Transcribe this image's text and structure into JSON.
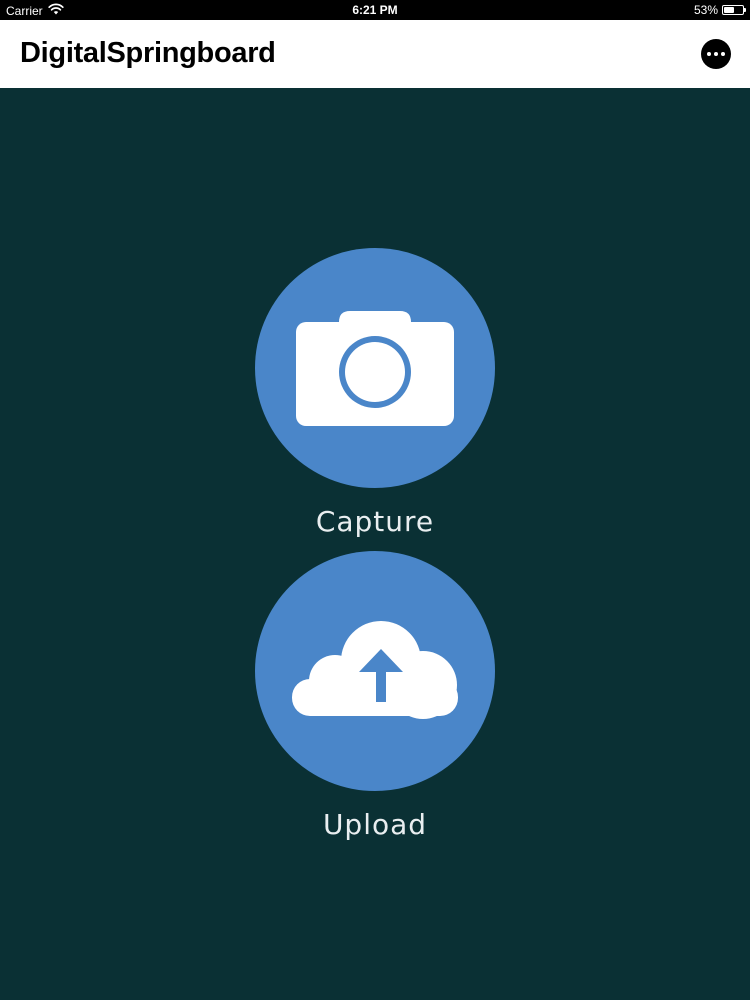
{
  "status_bar": {
    "carrier": "Carrier",
    "time": "6:21 PM",
    "battery_percent": "53%",
    "battery_level": 0.53,
    "wifi_icon": "wifi-icon",
    "battery_icon": "battery-icon"
  },
  "nav": {
    "title": "DigitalSpringboard",
    "more_icon": "more-icon"
  },
  "actions": {
    "capture": {
      "label": "Capture",
      "icon": "camera-icon"
    },
    "upload": {
      "label": "Upload",
      "icon": "cloud-upload-icon"
    }
  },
  "colors": {
    "background": "#0a3034",
    "accent": "#4a86c9",
    "label": "#e9eef0"
  }
}
